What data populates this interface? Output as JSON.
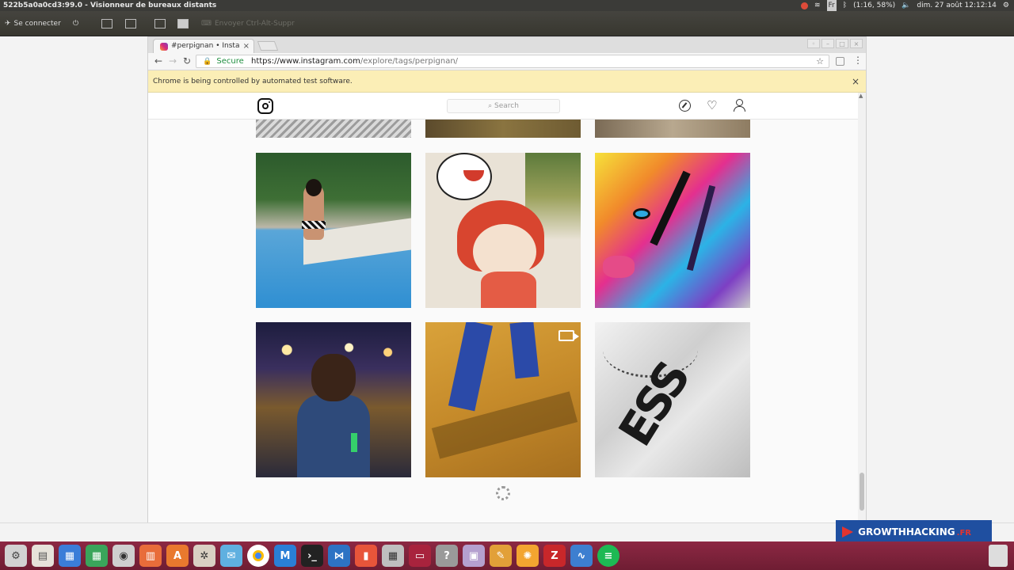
{
  "system_bar": {
    "title": "522b5a0a0cd3:99.0 - Visionneur de bureaux distants",
    "battery": "(1:16, 58%)",
    "datetime": "dim. 27 août 12:12:14",
    "keyboard": "Fr"
  },
  "viewer_toolbar": {
    "connect_label": "Se connecter",
    "ctrl_alt_del_label": "Envoyer Ctrl-Alt-Suppr"
  },
  "browser": {
    "tab_title": "#perpignan • Insta",
    "url_secure_label": "Secure",
    "url_host": "https://www.instagram.com",
    "url_path": "/explore/tags/perpignan/",
    "infobar_text": "Chrome is being controlled by automated test software."
  },
  "instagram": {
    "search_placeholder": "Search"
  },
  "badge": {
    "brand": "GROWTHHACKING",
    "tld": ".FR"
  },
  "colors": {
    "taskbar": "#7a2138",
    "infobar": "#fbeeb6",
    "secure_green": "#1e8e3e",
    "badge_blue": "#1f4fa0"
  }
}
